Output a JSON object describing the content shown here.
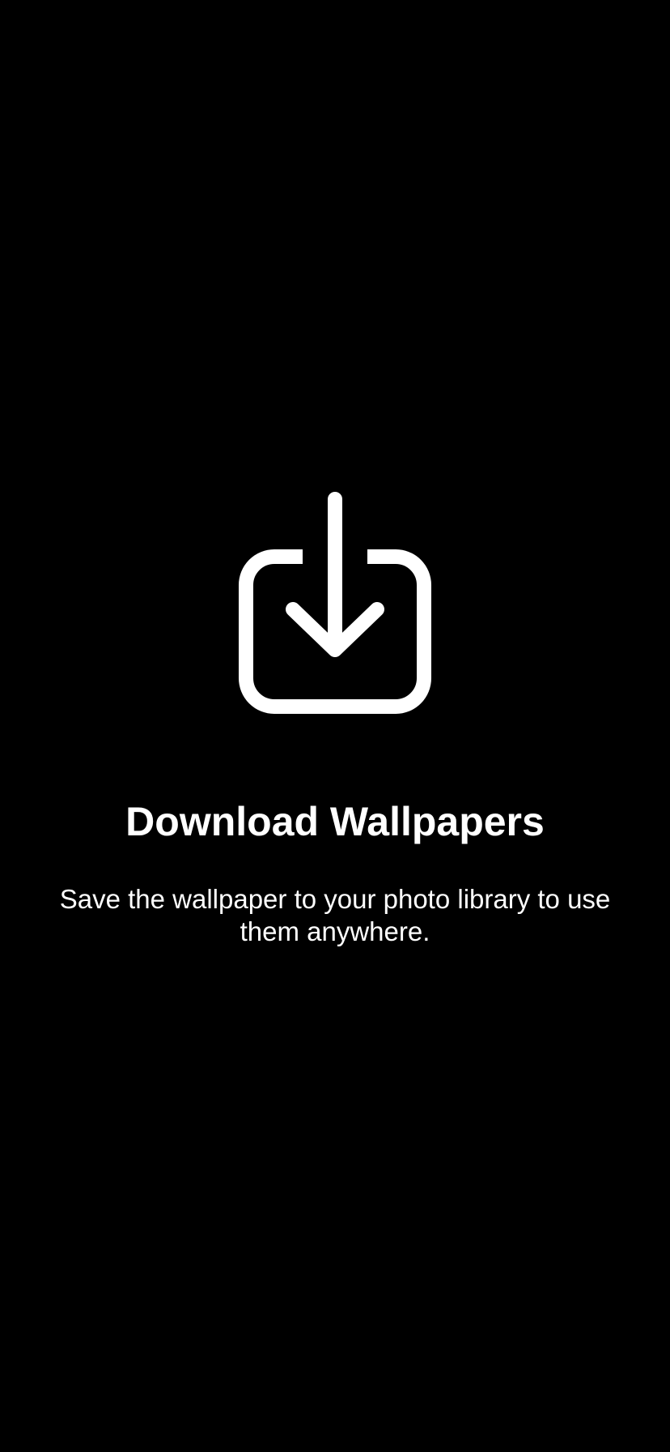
{
  "screen": {
    "background_color": "#000000",
    "foreground_color": "#ffffff",
    "icon": "download-icon",
    "title": "Download Wallpapers",
    "description": "Save the wallpaper to your photo library to use them anywhere."
  }
}
